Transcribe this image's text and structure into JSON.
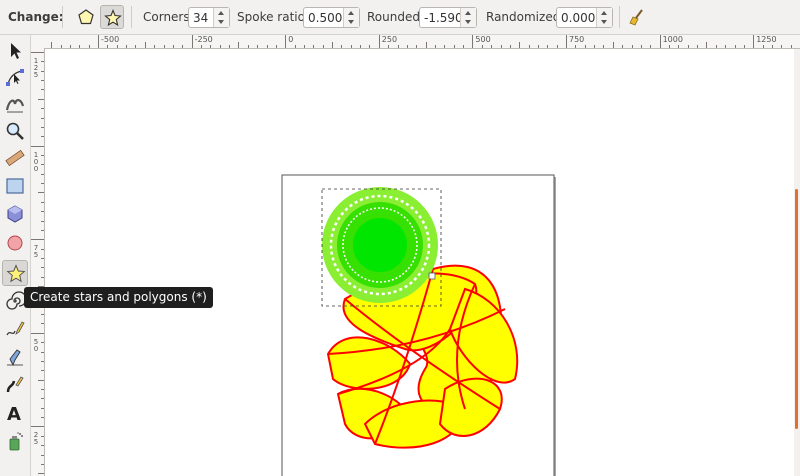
{
  "controls": {
    "change_label": "Change:",
    "corners_label": "Corners:",
    "corners_value": "34",
    "spoke_label": "Spoke ratio:",
    "spoke_value": "0.500",
    "rounded_label": "Rounded:",
    "rounded_value": "-1.590",
    "randomized_label": "Randomized:",
    "randomized_value": "0.000"
  },
  "ruler": {
    "h_labels": [
      "-500",
      "-250",
      "0",
      "250",
      "500",
      "750",
      "1000",
      "1250"
    ],
    "v_labels": [
      "125",
      "100",
      "75",
      "50",
      "25"
    ]
  },
  "tooltip": "Create stars and polygons (*)",
  "icons": {
    "polygon_mode": "pentagon-icon",
    "star_mode": "star-icon",
    "reset": "broom-icon",
    "tools": [
      "selector-arrow-icon",
      "node-editor-icon",
      "tweak-icon",
      "zoom-icon",
      "measure-icon",
      "rectangle-icon",
      "box3d-icon",
      "ellipse-icon",
      "star-icon",
      "spiral-icon",
      "pencil-icon",
      "pen-icon",
      "calligraphy-icon",
      "text-icon",
      "spray-icon"
    ]
  },
  "colors": {
    "yellow_fill": "#ffff00",
    "red_stroke": "#ff0000",
    "green_fill": "#00e600",
    "scroll_accent": "#e0702f"
  }
}
